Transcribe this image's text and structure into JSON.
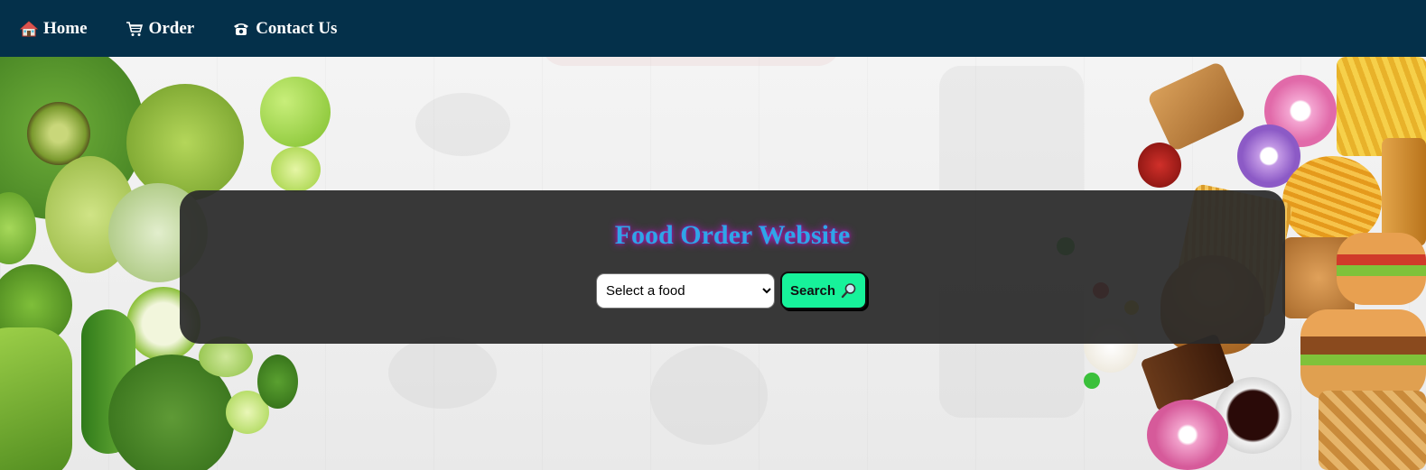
{
  "nav": {
    "items": [
      {
        "label": "Home",
        "icon": "house-icon"
      },
      {
        "label": "Order",
        "icon": "shopping-cart-icon"
      },
      {
        "label": "Contact Us",
        "icon": "telephone-icon"
      }
    ]
  },
  "hero": {
    "title": "Food Order Website",
    "select": {
      "selected": "Select a food"
    },
    "search_button": {
      "label": "Search",
      "icon": "magnifier-icon"
    }
  },
  "colors": {
    "nav_bg": "#04304a",
    "title_text": "#2fa5e8",
    "title_glow": "#c21ad0",
    "search_button_bg": "#17f29a",
    "panel_bg": "#2a2a2a"
  }
}
